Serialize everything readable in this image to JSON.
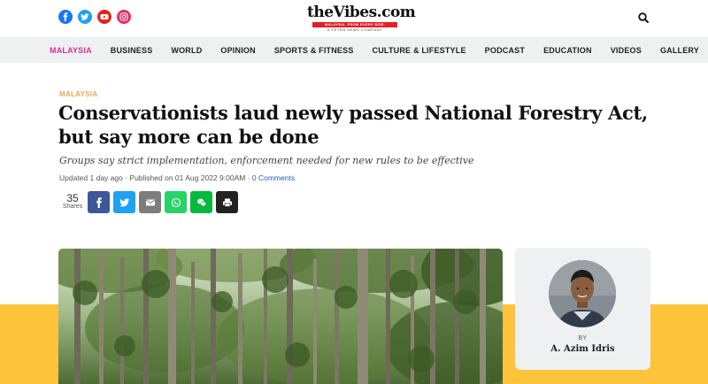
{
  "header": {
    "logo_brand_prefix": "the",
    "logo_brand_v": "V",
    "logo_brand_suffix": "ibes.com",
    "logo_tagline": "MALAYSIA. FROM EVERY SIDE.",
    "logo_sub": "A PETRA NEWS COMPANY",
    "social": [
      "facebook-icon",
      "twitter-icon",
      "youtube-icon",
      "instagram-icon"
    ],
    "colors": {
      "facebook": "#1877f2",
      "twitter": "#1da1f2",
      "youtube": "#e62117",
      "instagram": "#e1306c"
    }
  },
  "nav": {
    "items": [
      "MALAYSIA",
      "BUSINESS",
      "WORLD",
      "OPINION",
      "SPORTS & FITNESS",
      "CULTURE & LIFESTYLE",
      "PODCAST",
      "EDUCATION",
      "VIDEOS",
      "GALLERY"
    ],
    "active": "MALAYSIA",
    "active_color": "#d6338a"
  },
  "article": {
    "section": "MALAYSIA",
    "headline": "Conservationists laud newly passed National Forestry Act, but say more can be done",
    "subhead": "Groups say strict implementation, enforcement needed for new rules to be effective",
    "updated": "Updated 1 day ago",
    "published": "Published on 01 Aug 2022 9:00AM",
    "comments": "0 Comments",
    "share_count": "35",
    "share_label": "Shares"
  },
  "share_buttons": [
    {
      "name": "share-facebook-button",
      "icon": "facebook-icon",
      "color": "#3b5998"
    },
    {
      "name": "share-twitter-button",
      "icon": "twitter-icon",
      "color": "#1da1f2"
    },
    {
      "name": "share-email-button",
      "icon": "email-icon",
      "color": "#7d7d7d"
    },
    {
      "name": "share-whatsapp-button",
      "icon": "whatsapp-icon",
      "color": "#25d366"
    },
    {
      "name": "share-wechat-button",
      "icon": "wechat-icon",
      "color": "#09b83e"
    },
    {
      "name": "share-print-button",
      "icon": "print-icon",
      "color": "#222222"
    }
  ],
  "author": {
    "by_label": "BY",
    "name": "A. Azim Idris"
  },
  "accent_band_color": "#fcc33b"
}
